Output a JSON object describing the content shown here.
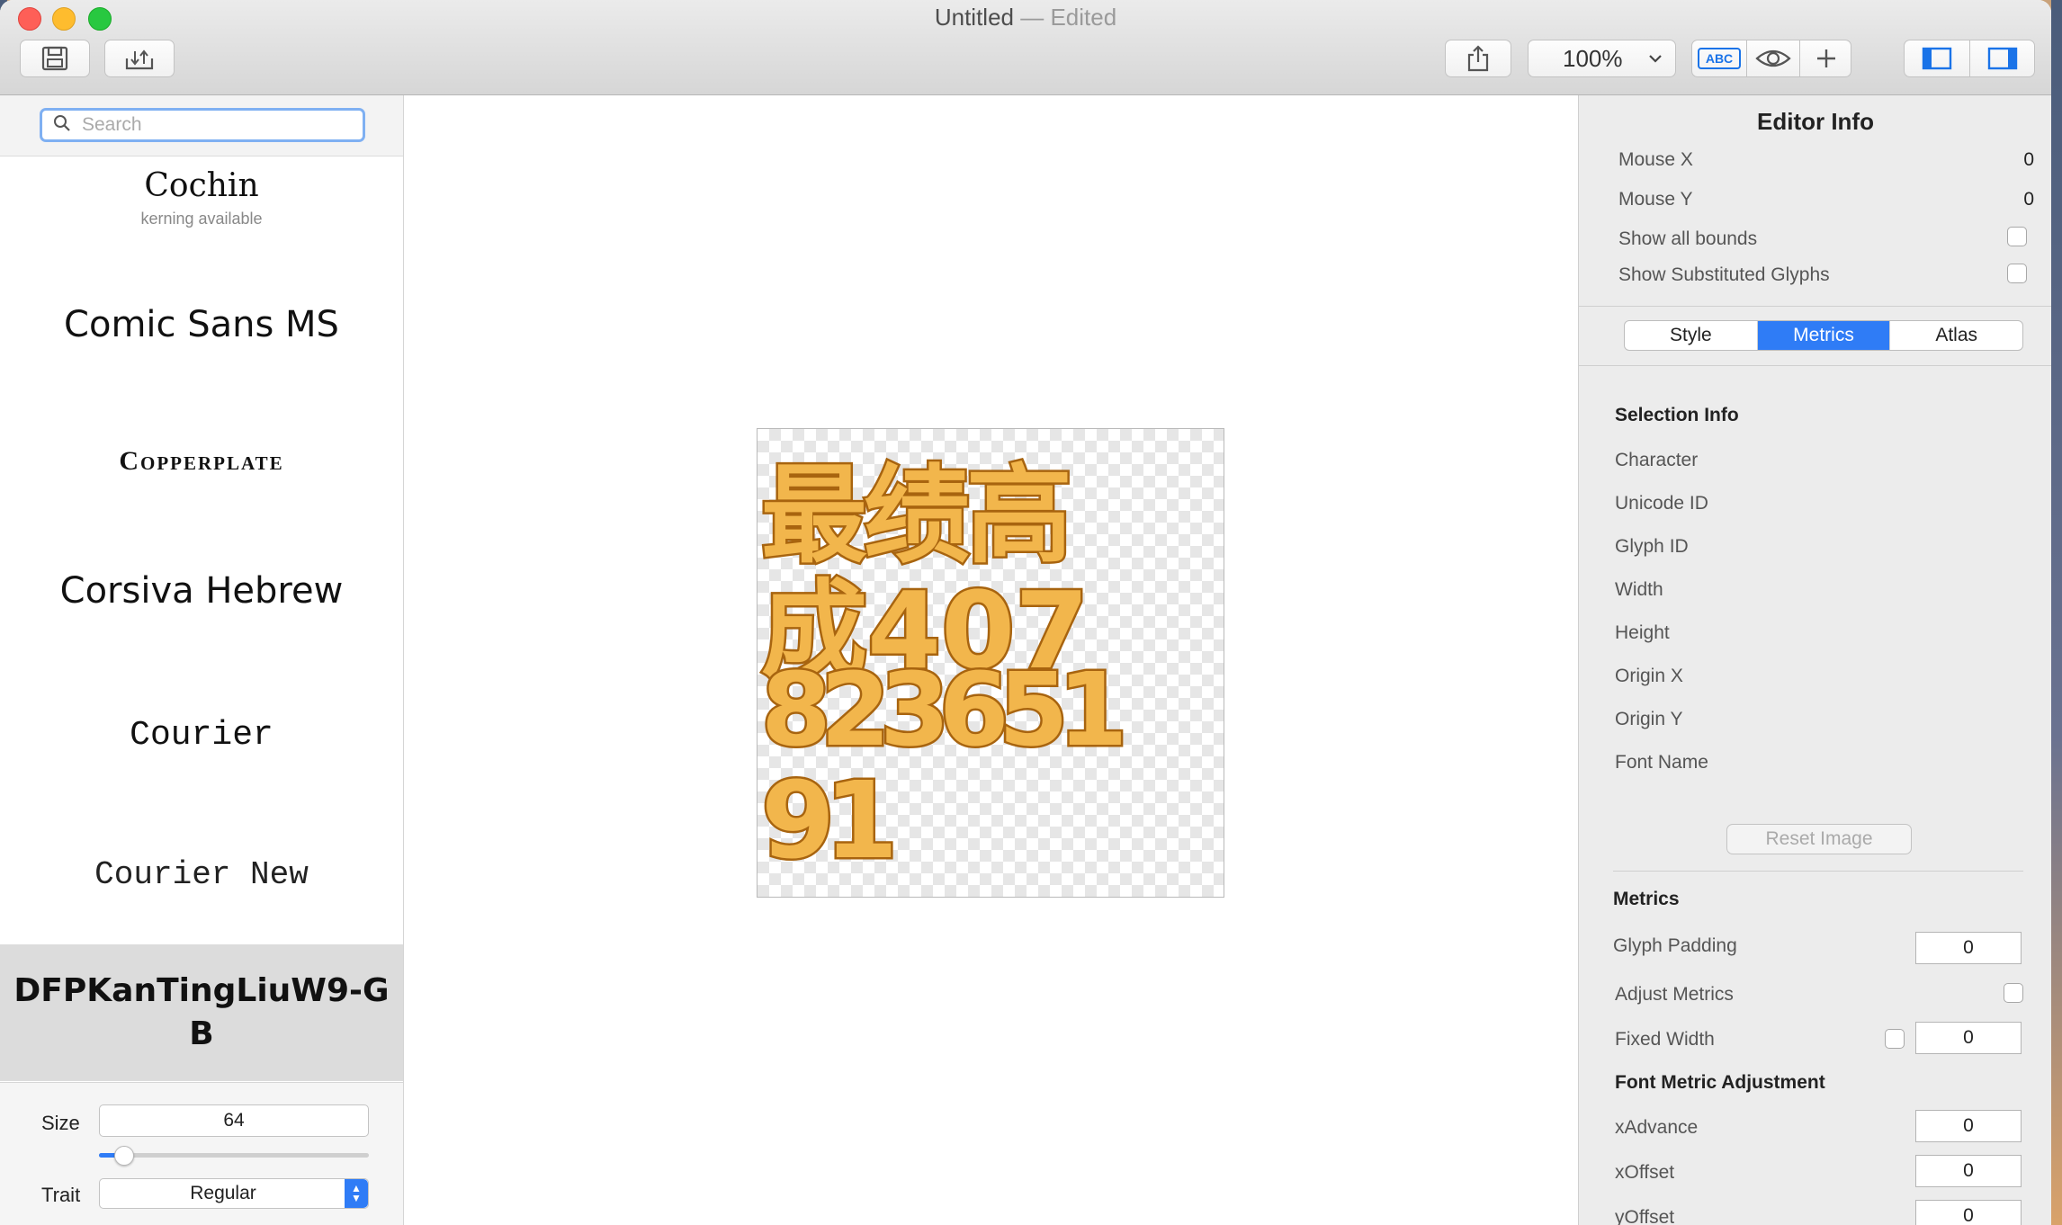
{
  "window": {
    "title": "Untitled",
    "title_suffix": "— Edited"
  },
  "toolbar": {
    "save_icon": "save-icon",
    "export_icon": "import-export-icon",
    "share_icon": "share-icon",
    "zoom_value": "100%",
    "spell_label": "ABC",
    "preview_icon": "eye-icon",
    "add_icon": "plus-icon",
    "left_panel_icon": "left-sidebar-icon",
    "right_panel_icon": "right-sidebar-icon"
  },
  "sidebar": {
    "search_placeholder": "Search",
    "fonts": [
      {
        "name": "Cochin",
        "note": "kerning available"
      },
      {
        "name": "Comic Sans MS"
      },
      {
        "name": "Copperplate"
      },
      {
        "name": "Corsiva Hebrew"
      },
      {
        "name": "Courier"
      },
      {
        "name": "Courier New"
      },
      {
        "name": "DFPKanTingLiuW9-GB",
        "selected": true
      }
    ],
    "size_label": "Size",
    "size_value": "64",
    "size_slider_fraction": 0.09,
    "trait_label": "Trait",
    "trait_value": "Regular"
  },
  "canvas": {
    "lines": [
      "最绩高",
      "成407",
      "823651",
      "91"
    ],
    "fill_color": "#f2b64c",
    "outline_color": "#a8640f"
  },
  "inspector": {
    "title": "Editor Info",
    "mouse_x_label": "Mouse X",
    "mouse_x_value": "0",
    "mouse_y_label": "Mouse Y",
    "mouse_y_value": "0",
    "show_bounds_label": "Show all bounds",
    "show_substituted_label": "Show Substituted Glyphs",
    "tabs": [
      {
        "label": "Style"
      },
      {
        "label": "Metrics",
        "active": true
      },
      {
        "label": "Atlas"
      }
    ],
    "selection_info_title": "Selection Info",
    "selection_fields": [
      "Character",
      "Unicode ID",
      "Glyph ID",
      "Width",
      "Height",
      "Origin X",
      "Origin Y",
      "Font Name"
    ],
    "reset_image_label": "Reset Image",
    "metrics_title": "Metrics",
    "glyph_padding_label": "Glyph Padding",
    "glyph_padding_value": "0",
    "adjust_metrics_label": "Adjust Metrics",
    "fixed_width_label": "Fixed Width",
    "fixed_width_value": "0",
    "font_metric_title": "Font Metric Adjustment",
    "xadvance_label": "xAdvance",
    "xadvance_value": "0",
    "xoffset_label": "xOffset",
    "xoffset_value": "0",
    "yoffset_label": "yOffset",
    "yoffset_value": "0"
  }
}
